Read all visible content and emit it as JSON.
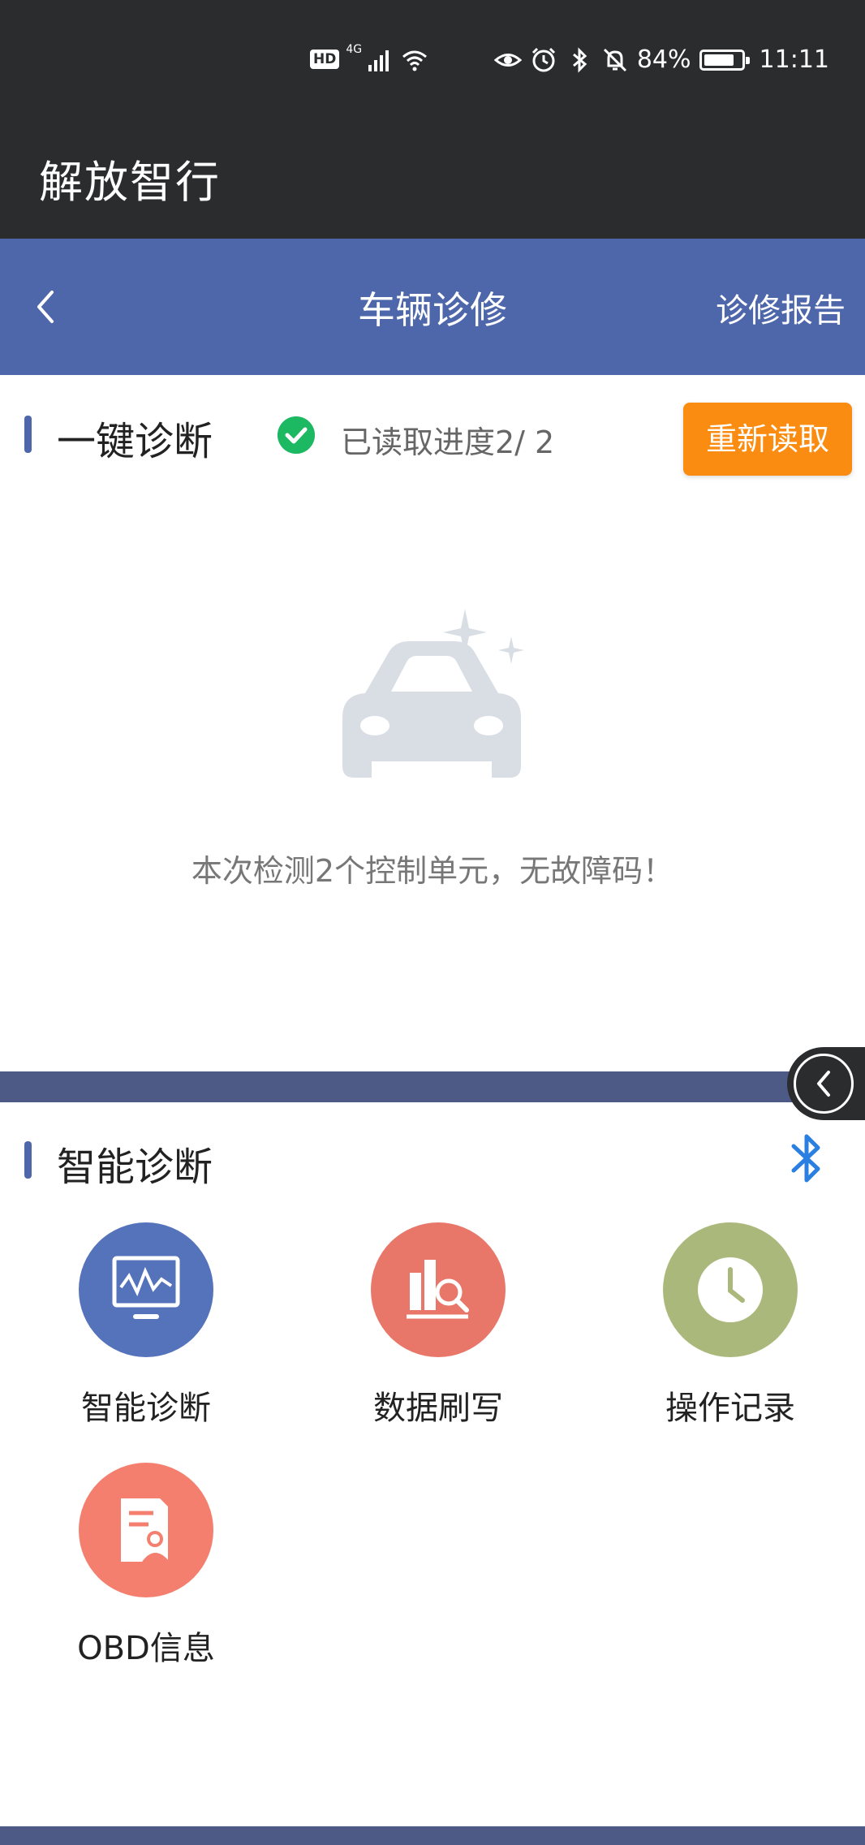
{
  "status_bar": {
    "hd": "HD",
    "network": "4G",
    "battery": "84%",
    "battery_level": 0.84,
    "time": "11:11",
    "icons": [
      "hd-icon",
      "signal-icon",
      "wifi-icon",
      "eye-icon",
      "alarm-icon",
      "bluetooth-icon",
      "mute-icon",
      "battery-icon"
    ]
  },
  "app": {
    "title": "解放智行"
  },
  "navbar": {
    "back_icon": "chevron-left-icon",
    "title": "车辆诊修",
    "report_label": "诊修报告"
  },
  "one_click": {
    "title": "一键诊断",
    "status_icon": "check-circle-icon",
    "progress_text": "已读取进度2/ 2",
    "reread_label": "重新读取",
    "illustration": "car-sparkle-icon",
    "result_text": "本次检测2个控制单元，无故障码！"
  },
  "smart": {
    "title": "智能诊断",
    "bluetooth_icon": "bluetooth-icon",
    "items": [
      {
        "label": "智能诊断",
        "icon": "monitor-waveform-icon",
        "color": "#5573bb"
      },
      {
        "label": "数据刷写",
        "icon": "data-search-icon",
        "color": "#e8776a"
      },
      {
        "label": "操作记录",
        "icon": "clock-icon",
        "color": "#aab97b"
      },
      {
        "label": "OBD信息",
        "icon": "document-user-icon",
        "color": "#f47f6e"
      }
    ]
  },
  "float_toggle_icon": "chevron-left-icon",
  "colors": {
    "nav": "#4e67ab",
    "accent": "#fb8c12",
    "dark": "#2b2c2e",
    "success": "#1db862"
  }
}
